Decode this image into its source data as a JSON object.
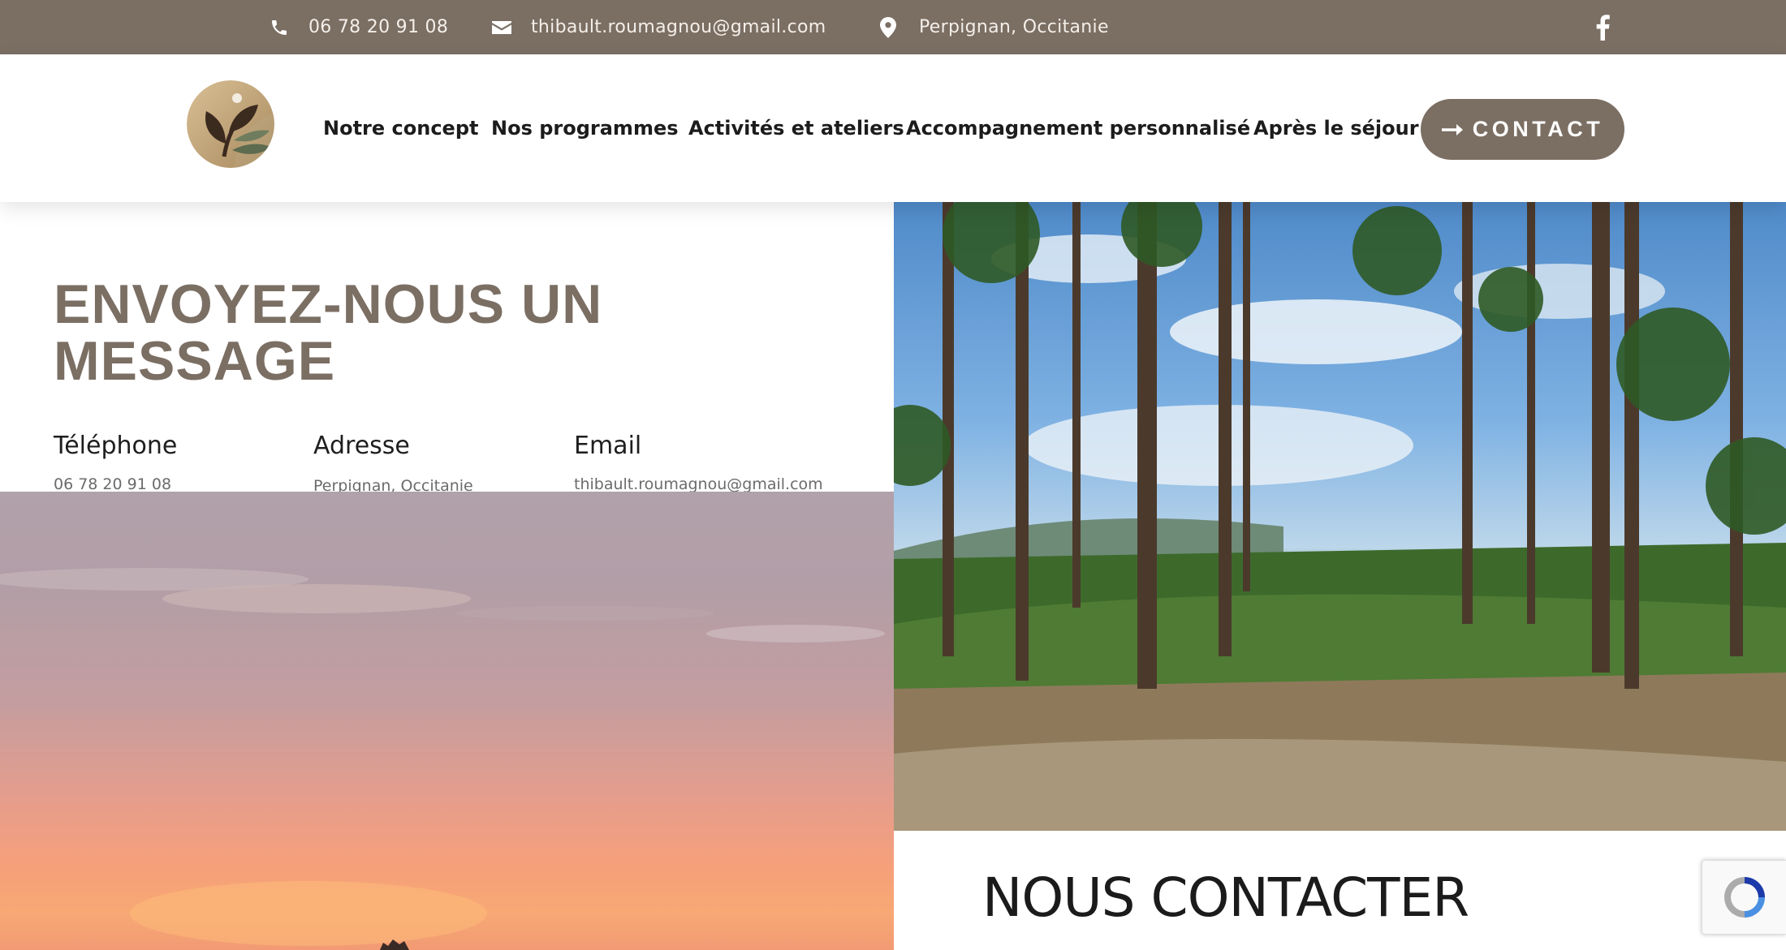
{
  "topbar": {
    "phone": "06 78 20 91 08",
    "email": "thibault.roumagnou@gmail.com",
    "location": "Perpignan, Occitanie",
    "background": "#7b6e63"
  },
  "nav": {
    "items": [
      {
        "label": "Notre concept"
      },
      {
        "label": "Nos programmes"
      },
      {
        "label": "Activités et ateliers"
      },
      {
        "label": "Accompagnement personnalisé"
      },
      {
        "label": "Après le séjour"
      }
    ],
    "cta": "CONTACT"
  },
  "form_section": {
    "title": "ENVOYEZ-NOUS UN MESSAGE",
    "phone_heading": "Téléphone",
    "phone_value": "06 78 20 91 08",
    "address_heading": "Adresse",
    "address_value": "Perpignan, Occitanie",
    "email_heading": "Email",
    "email_value": "thibault.roumagnou@gmail.com"
  },
  "contact_section": {
    "heading": "NOUS CONTACTER"
  },
  "colors": {
    "accent": "#7b6e63",
    "text_dark": "#1c1c1c"
  },
  "icons": {
    "phone": "phone-icon",
    "email": "envelope-icon",
    "location": "map-pin-icon",
    "social": "facebook-icon",
    "cta": "arrow-right-icon",
    "captcha": "recaptcha-icon"
  }
}
